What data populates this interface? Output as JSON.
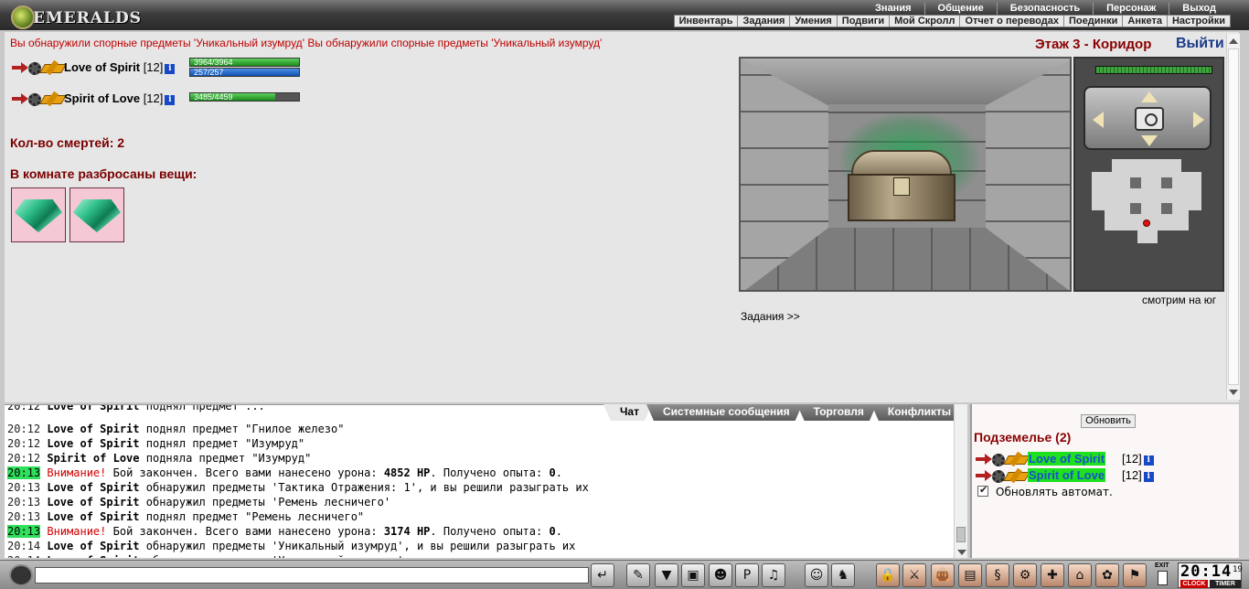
{
  "header": {
    "logo_text": "EMERALDS",
    "nav_top": [
      "Знания",
      "Общение",
      "Безопасность",
      "Персонаж",
      "Выход"
    ],
    "nav_bottom": [
      "Инвентарь",
      "Задания",
      "Умения",
      "Подвиги",
      "Мой Скролл",
      "Отчет о переводах",
      "Поединки",
      "Анкета",
      "Настройки"
    ]
  },
  "main": {
    "notice": "Вы обнаружили спорные предметы 'Уникальный изумруд' Вы обнаружили спорные предметы 'Уникальный изумруд'",
    "floor_title": "Этаж 3 - Коридор",
    "exit_label": "Выйти",
    "players": [
      {
        "name": "Love of Spirit",
        "level": "[12]",
        "hp_text": "3964/3964",
        "hp_fraction": 1.0,
        "mp_text": "257/257",
        "mp_fraction": 1.0
      },
      {
        "name": "Spirit of Love",
        "level": "[12]",
        "hp_text": "3485/4459",
        "hp_fraction": 0.78
      }
    ],
    "deaths_label": "Кол-во смертей: 2",
    "items_title": "В комнате разбросаны вещи:",
    "items": [
      "emerald-item",
      "emerald-item"
    ],
    "look_direction": "смотрим на юг",
    "quests_link": "Задания >>"
  },
  "chat": {
    "tabs": [
      "Чат",
      "Системные сообщения",
      "Торговля",
      "Конфликты"
    ],
    "lines": [
      {
        "time": "20:12",
        "name": "Love of Spirit",
        "text": " поднял предмет \"Гнилое железо\""
      },
      {
        "time": "20:12",
        "name": "Love of Spirit",
        "text": " поднял предмет \"Изумруд\""
      },
      {
        "time": "20:12",
        "name": "Spirit of Love",
        "text": " подняла предмет \"Изумруд\""
      },
      {
        "time": "20:13",
        "highlight": true,
        "warn": "Внимание!",
        "text": " Бой закончен. Всего вами нанесено урона: ",
        "b1": "4852 HP",
        "text2": ". Получено опыта: ",
        "b2": "0",
        "text3": "."
      },
      {
        "time": "20:13",
        "name": "Love of Spirit",
        "text": " обнаружил предметы 'Тактика Отражения: 1', и вы решили разыграть их"
      },
      {
        "time": "20:13",
        "name": "Love of Spirit",
        "text": " обнаружил предметы 'Ремень лесничего'"
      },
      {
        "time": "20:13",
        "name": "Love of Spirit",
        "text": " поднял предмет \"Ремень лесничего\""
      },
      {
        "time": "20:13",
        "highlight": true,
        "warn": "Внимание!",
        "text": " Бой закончен. Всего вами нанесено урона: ",
        "b1": "3174 HP",
        "text2": ". Получено опыта: ",
        "b2": "0",
        "text3": "."
      },
      {
        "time": "20:14",
        "name": "Love of Spirit",
        "text": " обнаружил предметы 'Уникальный изумруд', и вы решили разыграть их"
      },
      {
        "time": "20:14",
        "name": "Love of Spirit",
        "text": " обнаружил предметы 'Уникальный изумруд', и вы решили разыграть их"
      }
    ]
  },
  "right_panel": {
    "refresh_button": "Обновить",
    "title": "Подземелье (2)",
    "members": [
      {
        "name": "Love of Spirit",
        "level": "[12]"
      },
      {
        "name": "Spirit of Love",
        "level": "[12]"
      }
    ],
    "auto_refresh_label": "Обновлять автомат."
  },
  "toolbar": {
    "chat_placeholder": "",
    "exit_label": "EXIT",
    "clock_time": "20:14",
    "clock_seconds": "19",
    "clock_label": "CLOCK",
    "timer_label": "TIMER"
  },
  "colors": {
    "accent_red": "#8a0000",
    "notice_red": "#c00000",
    "highlight_green": "#1ee01e",
    "hp_green": "#1a8a1a",
    "mp_blue": "#1050b0"
  }
}
